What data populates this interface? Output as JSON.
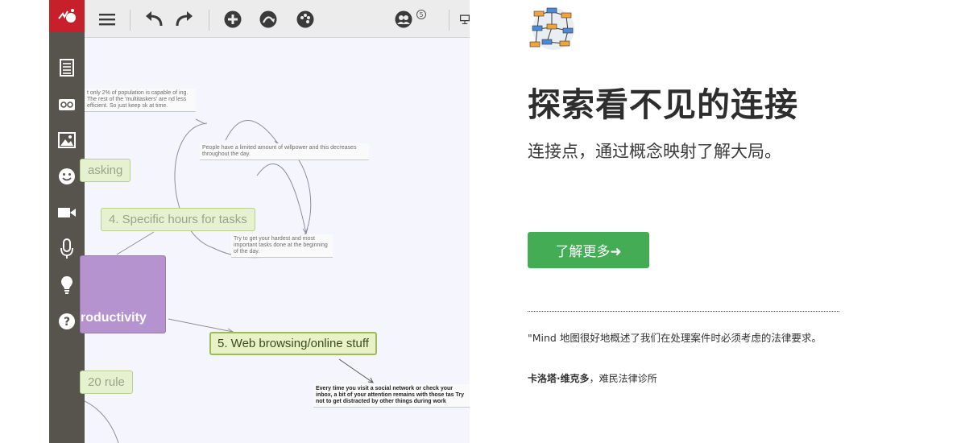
{
  "app": {
    "toolbar": {
      "collaborators_count": "5"
    },
    "mindmap": {
      "nodes": {
        "multitasking": "asking",
        "specific_hours": "4. Specific hours for tasks",
        "productivity": "roductivity",
        "web_browsing": "5. Web browsing/online stuff",
        "rule": "20 rule"
      },
      "notes": {
        "multitask_note": "t only 2% of population is capable of ing. The rest of the 'multitaskers' are nd less efficient. So just keep sk at time.",
        "willpower_note": "People have a limited amount of willpower and this decreases throughout the day.",
        "hardest_note": "Try to get your hardest and most important tasks done at the beginning of the day.",
        "browsing_note": "Every time you visit a social network or check your inbox, a bit of  your attention remains with those tas Try not to get distracted by other things during work"
      }
    }
  },
  "marketing": {
    "headline": "探索看不见的连接",
    "subheadline": "连接点，通过概念映射了解大局。",
    "cta_label": "了解更多➜",
    "quote": "\"Mind 地图很好地概述了我们在处理案件时必须考虑的法律要求。",
    "author_name": "卡洛塔·维克多",
    "author_org": "难民法律诊所"
  },
  "colors": {
    "sidebar": "#57534d",
    "logo": "#c8202a",
    "cta": "#45ac56",
    "purple_node": "#b493cf",
    "green_node": "#e6f2cf"
  }
}
